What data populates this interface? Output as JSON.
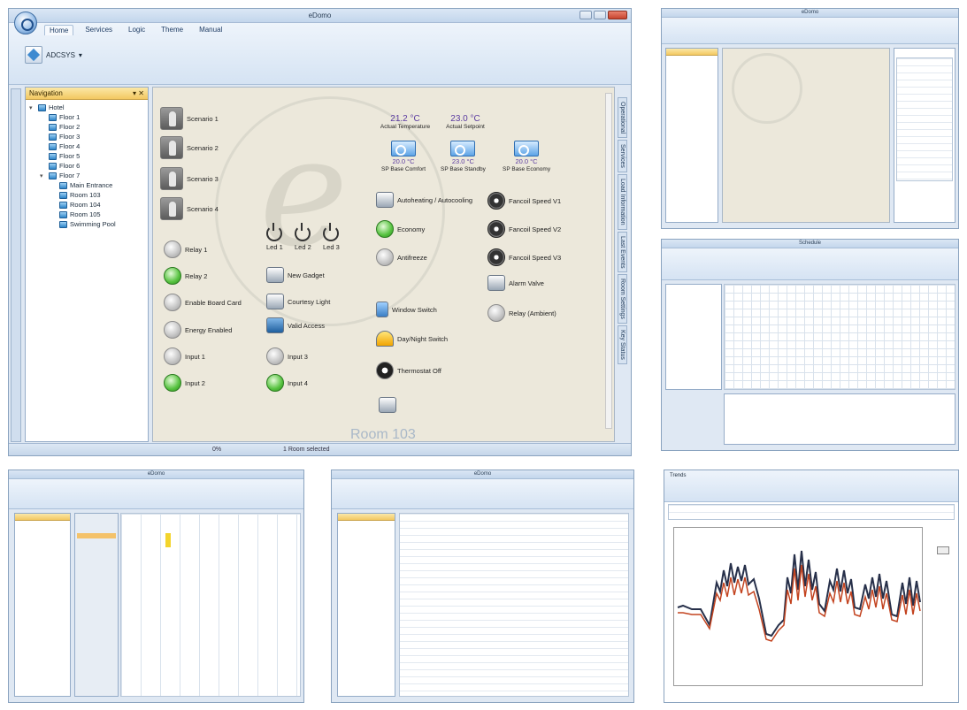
{
  "main": {
    "window_title": "eDomo",
    "tabs": [
      "Home",
      "Services",
      "Logic",
      "Theme",
      "Manual"
    ],
    "ribbon_button": "ADCSYS",
    "navigation_title": "Navigation",
    "tree": [
      {
        "label": "Hotel",
        "level": 0
      },
      {
        "label": "Floor 1",
        "level": 1
      },
      {
        "label": "Floor 2",
        "level": 1
      },
      {
        "label": "Floor 3",
        "level": 1
      },
      {
        "label": "Floor 4",
        "level": 1
      },
      {
        "label": "Floor 5",
        "level": 1
      },
      {
        "label": "Floor 6",
        "level": 1
      },
      {
        "label": "Floor 7",
        "level": 1
      },
      {
        "label": "Main Entrance",
        "level": 2
      },
      {
        "label": "Room 103",
        "level": 2
      },
      {
        "label": "Room 104",
        "level": 2
      },
      {
        "label": "Room 105",
        "level": 2
      },
      {
        "label": "Swimming Pool",
        "level": 2
      }
    ],
    "scenes": [
      "Scenario 1",
      "Scenario 2",
      "Scenario 3",
      "Scenario 4"
    ],
    "temperatures": {
      "actual_value": "21.2 °C",
      "actual_label": "Actual Temperature",
      "setpoint_value": "23.0 °C",
      "setpoint_label": "Actual Setpoint"
    },
    "setpoints": [
      {
        "value": "20.0 °C",
        "label": "SP Base Comfort"
      },
      {
        "value": "23.0 °C",
        "label": "SP Base Standby"
      },
      {
        "value": "20.0 °C",
        "label": "SP Base Economy"
      }
    ],
    "leds": [
      "Led 1",
      "Led 2",
      "Led 3"
    ],
    "left_devices": [
      "Relay 1",
      "Relay 2",
      "Enable Board Card",
      "Energy Enabled",
      "Input 1",
      "Input 2"
    ],
    "mid_devices": [
      "New Gadget",
      "Courtesy Light",
      "Valid Access",
      "Input 3",
      "Input 4"
    ],
    "climate_devices": [
      "Autoheating / Autocooling",
      "Economy",
      "Antifreeze",
      "Window Switch",
      "Day/Night Switch",
      "Thermostat Off"
    ],
    "fan_devices": [
      "Fancoil Speed V1",
      "Fancoil Speed V2",
      "Fancoil Speed V3",
      "Alarm Valve",
      "Relay (Ambient)"
    ],
    "room_label": "Room 103",
    "vertical_tabs": [
      "Operational",
      "Services",
      "Load Information",
      "Last Events",
      "Room Settings",
      "Key Status",
      "Clim Valve Controls"
    ],
    "status": {
      "left": "0%",
      "center": "1 Room selected"
    }
  },
  "thumbs": {
    "t1_title": "eDomo",
    "t2_title": "Schedule",
    "t3_title": "eDomo",
    "t4_title": "eDomo",
    "t5_title": "Trends"
  },
  "colors": {
    "accent": "#3e8ad0",
    "panel_head": "#f3c861",
    "series_dark": "#27304a",
    "series_red": "#c3431f"
  }
}
